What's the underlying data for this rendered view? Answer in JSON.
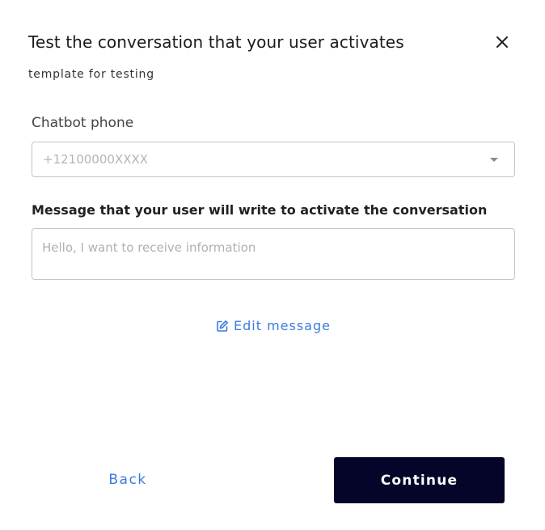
{
  "dialog": {
    "title": "Test the conversation that your user activates",
    "subtitle": "template for testing"
  },
  "phone_field": {
    "label": "Chatbot phone",
    "value": "+12100000XXXX"
  },
  "message_field": {
    "label": "Message that your user will write to activate the conversation",
    "placeholder": "Hello, I want to receive information"
  },
  "edit_link": {
    "label": "Edit message",
    "icon": "edit-icon"
  },
  "buttons": {
    "back": "Back",
    "continue": "Continue"
  },
  "colors": {
    "link": "#3b7be0",
    "primary_button": "#05052a"
  }
}
